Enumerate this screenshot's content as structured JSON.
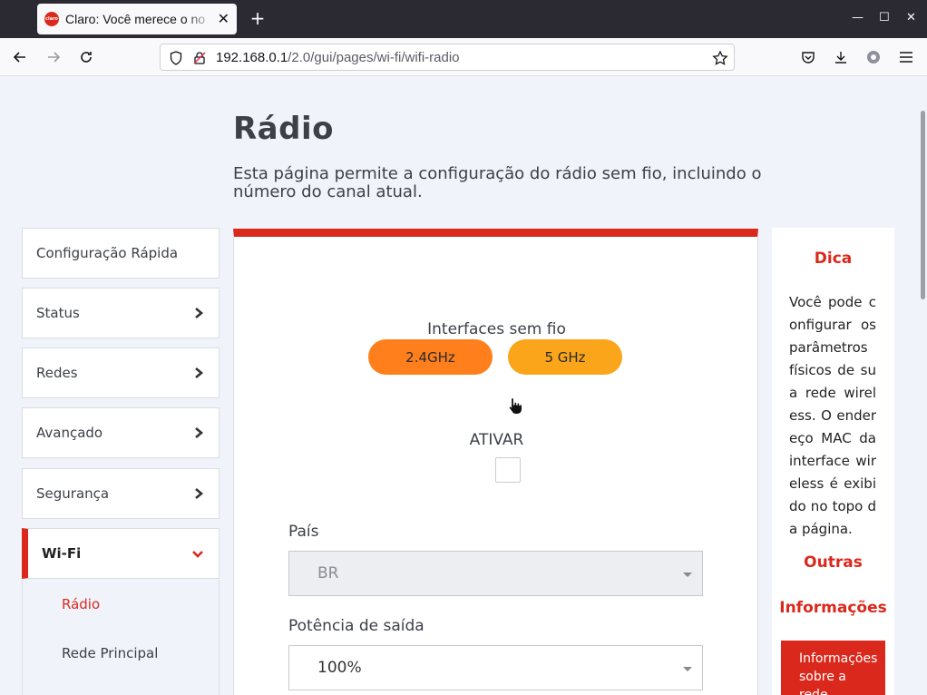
{
  "browser": {
    "tab_title": "Claro: Você merece o no",
    "favicon_text": "claro",
    "url_host": "192.168.0.1",
    "url_path": "/2.0/gui/pages/wi-fi/wifi-radio"
  },
  "page": {
    "title": "Rádio",
    "description": "Esta página permite a configuração do rádio sem fio, incluindo o número do canal atual."
  },
  "sidebar": {
    "items": [
      {
        "label": "Configuração Rápida",
        "has_chevron": false
      },
      {
        "label": "Status",
        "has_chevron": true
      },
      {
        "label": "Redes",
        "has_chevron": true
      },
      {
        "label": "Avançado",
        "has_chevron": true
      },
      {
        "label": "Segurança",
        "has_chevron": true
      },
      {
        "label": "Wi-Fi",
        "has_chevron": true,
        "expanded": true
      }
    ],
    "subitems": [
      {
        "label": "Rádio",
        "active": true
      },
      {
        "label": "Rede Principal",
        "active": false
      }
    ]
  },
  "main": {
    "interfaces_label": "Interfaces sem fio",
    "interfaces": [
      {
        "label": "2.4GHz",
        "selected": true,
        "color": "#ff7f1c"
      },
      {
        "label": "5 GHz",
        "selected": false,
        "color": "#faa51a"
      }
    ],
    "activate_label": "ATIVAR",
    "activate_checked": false,
    "country_label": "País",
    "country_value": "BR",
    "power_label": "Potência de saída",
    "power_value": "100%"
  },
  "hint": {
    "title": "Dica",
    "text": "Você pode configurar os parâmetros físicos de sua rede wireless. O endereço MAC da interface wireless é exibido no topo da página.",
    "more_1": "Outras",
    "more_2": "Informações",
    "box_text": "Informações sobre a rede"
  },
  "colors": {
    "accent": "#da291c",
    "page_bg": "#f0f3fa"
  }
}
